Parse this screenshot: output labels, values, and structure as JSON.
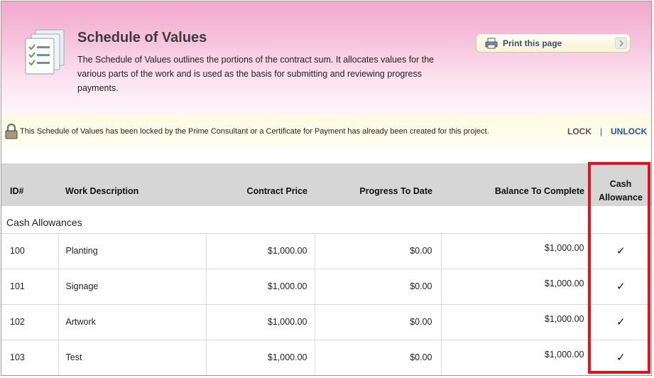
{
  "header": {
    "title": "Schedule of Values",
    "description": "The Schedule of Values outlines the portions of the contract sum. It allocates values for the various parts of the work and is used as the basis for submitting and reviewing progress payments.",
    "print_label": "Print this page"
  },
  "notice": {
    "text": "This Schedule of Values has been locked by the Prime Consultant or a Certificate for Payment has already been created for this project.",
    "lock_label": "LOCK",
    "separator": "|",
    "unlock_label": "UNLOCK"
  },
  "table": {
    "columns": {
      "id": "ID#",
      "description": "Work Description",
      "contract_price": "Contract Price",
      "progress": "Progress To Date",
      "balance": "Balance To Complete",
      "cash_line1": "Cash",
      "cash_line2": "Allowance"
    },
    "group_label": "Cash Allowances",
    "rows": [
      {
        "id": "100",
        "description": "Planting",
        "contract_price": "$1,000.00",
        "progress": "$0.00",
        "balance": "$1,000.00",
        "cash": "✓"
      },
      {
        "id": "101",
        "description": "Signage",
        "contract_price": "$1,000.00",
        "progress": "$0.00",
        "balance": "$1,000.00",
        "cash": "✓"
      },
      {
        "id": "102",
        "description": "Artwork",
        "contract_price": "$1,000.00",
        "progress": "$0.00",
        "balance": "$1,000.00",
        "cash": "✓"
      },
      {
        "id": "103",
        "description": "Test",
        "contract_price": "$1,000.00",
        "progress": "$0.00",
        "balance": "$1,000.00",
        "cash": "✓"
      }
    ]
  },
  "colors": {
    "header_pink": "#f2a9cc",
    "notice_yellow": "#fffbe0",
    "highlight_red": "#e0141d",
    "unlock_blue": "#1f56b3"
  },
  "icons": {
    "header": "checklist-document-icon",
    "print": "printer-icon",
    "print_arrow": "chevron-right-icon",
    "lock": "padlock-icon"
  }
}
